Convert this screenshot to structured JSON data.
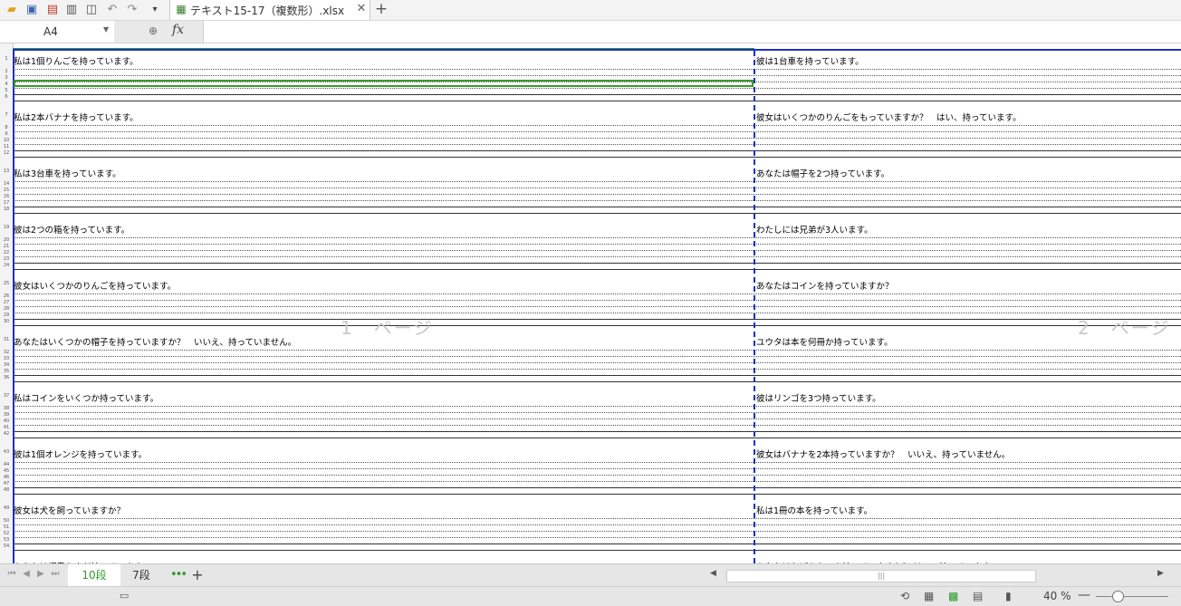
{
  "toolbar": {
    "icons": [
      "open-folder-icon",
      "save-icon",
      "export-pdf-icon",
      "print-icon",
      "print-preview-icon",
      "undo-icon",
      "redo-icon",
      "customize-icon"
    ]
  },
  "document_tab": {
    "title": "テキスト15-17（複数形）.xlsx",
    "close": "✕",
    "add": "+"
  },
  "formula_bar": {
    "cell_ref": "A4",
    "fx": "fx",
    "value": ""
  },
  "sheet": {
    "row_numbers": [
      "1",
      "2",
      "3",
      "4",
      "5",
      "6",
      "7",
      "8",
      "9",
      "10",
      "11",
      "12",
      "13",
      "14",
      "15",
      "16",
      "17",
      "18",
      "19",
      "20",
      "21",
      "22",
      "23",
      "24",
      "25",
      "26",
      "27",
      "28",
      "29",
      "30",
      "31",
      "32",
      "33",
      "34",
      "35",
      "36",
      "37",
      "38",
      "39",
      "40",
      "41",
      "42",
      "43",
      "44",
      "45",
      "46",
      "47",
      "48",
      "49",
      "50",
      "51",
      "52",
      "53",
      "54"
    ],
    "left_column": [
      "私は1個りんごを持っています。",
      "私は2本バナナを持っています。",
      "私は3台車を持っています。",
      "彼は2つの箱を持っています。",
      "彼女はいくつかのりんごを持っています。",
      "あなたはいくつかの帽子を持っていますか？　いいえ、持っていません。",
      "私はコインをいくつか持っています。",
      "彼は1個オレンジを持っています。",
      "彼女は犬を飼っていますか？",
      "あなたは帽子をまだ持っています。"
    ],
    "right_column": [
      "彼は1台車を持っています。",
      "彼女はいくつかのりんごをもっていますか？　はい、持っています。",
      "あなたは帽子を2つ持っています。",
      "わたしには兄弟が3人います。",
      "あなたはコインを持っていますか？",
      "ユウタは本を何冊か持っています。",
      "彼はリンゴを3つ持っています。",
      "彼女はバナナを2本持っていますか？　いいえ、持っていません。",
      "私は1冊の本を持っています。",
      "あなたはおばあちゃん持っていますか？ はい、持っています。"
    ],
    "watermarks": [
      "1　ページ",
      "2　ページ"
    ]
  },
  "sheet_bar": {
    "tabs": [
      {
        "label": "10段",
        "active": true
      },
      {
        "label": "7段",
        "active": false
      }
    ],
    "more": "•••",
    "add": "+",
    "scroll_grip": "|||"
  },
  "status_bar": {
    "zoom": "40 %",
    "zoom_minus": "—"
  },
  "colors": {
    "accent": "#2e9a2e",
    "page_border": "#1f2fc8"
  }
}
